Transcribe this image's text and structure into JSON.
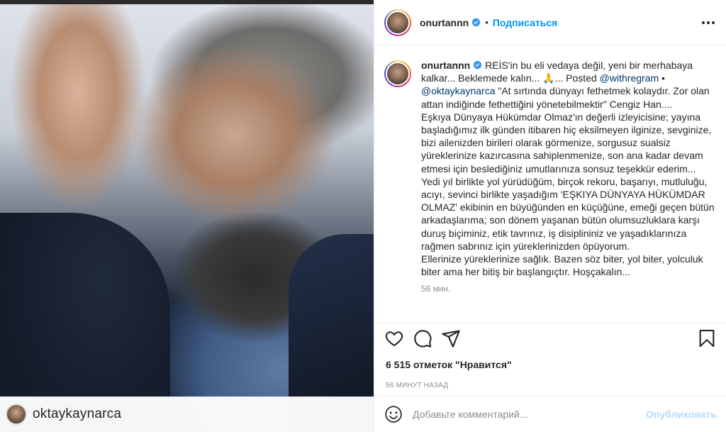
{
  "post": {
    "author": {
      "username": "onurtannn",
      "verified": true,
      "follow_label": "Подписаться",
      "dot": "•"
    },
    "media": {
      "tagged_user": "oktaykaynarca"
    },
    "caption": {
      "username": "onurtannn",
      "part1": " REİS'in bu eli vedaya değil, yeni bir merhabaya kalkar... Beklemede kalın... 🙏... Posted ",
      "mention1": "@withregram",
      "part2": " • ",
      "mention2": "@oktaykaynarca",
      "part3": " \"At sırtında dünyayı fethetmek kolaydır. Zor olan attan indiğinde fethettiğini yönetebilmektir\" Cengiz Han....\nEşkıya Dünyaya Hükümdar Olmaz'ın değerli izleyicisine; yayına başladığımız ilk günden itibaren hiç eksilmeyen ilginize, sevginize, bizi ailenizden birileri olarak görmenize, sorgusuz sualsiz yüreklerinize kazırcasına sahiplenmenize, son ana kadar devam etmesi için beslediğiniz umutlarınıza sonsuz teşekkür ederim... Yedi yıl birlikte yol yürüdüğüm, birçok rekoru, başarıyı, mutluluğu, acıyı, sevinci birlikte yaşadığım 'EŞKIYA DÜNYAYA HÜKÜMDAR OLMAZ' ekibinin en büyüğünden en küçüğüne, emeği geçen bütün arkadaşlarıma; son dönem yaşanan bütün olumsuzluklara karşı duruş biçiminiz, etik tavrınız, iş disiplininiz ve yaşadıklarınıza rağmen sabrınız için yüreklerinizden öpüyorum.\nEllerinize yüreklerinize sağlık. Bazen söz biter, yol biter, yolculuk biter ama her bitiş bir başlangıçtır. Hoşçakalın...",
      "time": "56 мин."
    },
    "likes": "6 515 отметок \"Нравится\"",
    "timestamp": "56 МИНУТ НАЗАД",
    "comment": {
      "placeholder": "Добавьте комментарий...",
      "publish_label": "Опубликовать"
    },
    "icons": {
      "like": "heart-icon",
      "comment": "comment-icon",
      "share": "share-icon",
      "save": "bookmark-icon",
      "emoji": "emoji-icon",
      "more": "more-icon",
      "verified": "verified-badge-icon"
    },
    "colors": {
      "link": "#0095f6",
      "mention": "#00376b",
      "muted": "#8e8e8e",
      "publish_disabled": "#b3dbff"
    }
  }
}
